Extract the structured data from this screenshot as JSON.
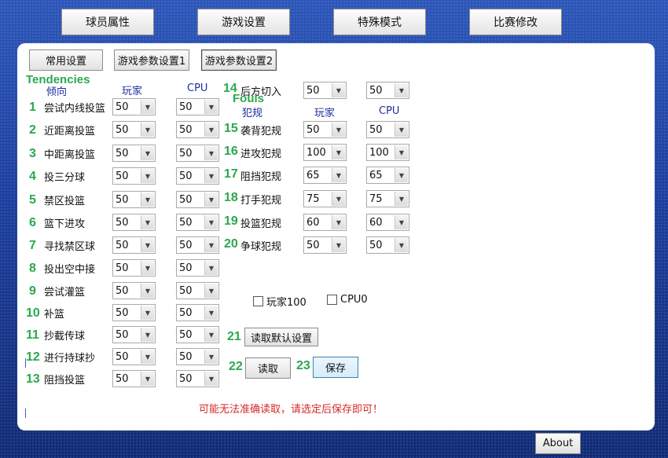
{
  "top_tabs": [
    "球员属性",
    "游戏设置",
    "特殊模式",
    "比赛修改"
  ],
  "sub_tabs": [
    "常用设置",
    "游戏参数设置1",
    "游戏参数设置2"
  ],
  "tendencies": {
    "title": "Tendencies",
    "col_label": "倾向",
    "col_player": "玩家",
    "col_cpu": "CPU",
    "rows": [
      {
        "num": "1",
        "label": "尝试内线投篮",
        "player": "50",
        "cpu": "50"
      },
      {
        "num": "2",
        "label": "近距离投篮",
        "player": "50",
        "cpu": "50"
      },
      {
        "num": "3",
        "label": "中距离投篮",
        "player": "50",
        "cpu": "50"
      },
      {
        "num": "4",
        "label": "投三分球",
        "player": "50",
        "cpu": "50"
      },
      {
        "num": "5",
        "label": "禁区投篮",
        "player": "50",
        "cpu": "50"
      },
      {
        "num": "6",
        "label": "篮下进攻",
        "player": "50",
        "cpu": "50"
      },
      {
        "num": "7",
        "label": "寻找禁区球",
        "player": "50",
        "cpu": "50"
      },
      {
        "num": "8",
        "label": "投出空中接",
        "player": "50",
        "cpu": "50"
      },
      {
        "num": "9",
        "label": "尝试灌篮",
        "player": "50",
        "cpu": "50"
      },
      {
        "num": "10",
        "label": "补篮",
        "player": "50",
        "cpu": "50"
      },
      {
        "num": "11",
        "label": "抄截传球",
        "player": "50",
        "cpu": "50"
      },
      {
        "num": "12",
        "label": "进行持球抄",
        "player": "50",
        "cpu": "50"
      },
      {
        "num": "13",
        "label": "阻挡投篮",
        "player": "50",
        "cpu": "50"
      }
    ],
    "row14": {
      "num": "14",
      "label": "后方切入",
      "player": "50",
      "cpu": "50"
    }
  },
  "fouls": {
    "title": "Fouls",
    "col_label": "犯规",
    "col_player": "玩家",
    "col_cpu": "CPU",
    "rows": [
      {
        "num": "15",
        "label": "袭背犯规",
        "player": "50",
        "cpu": "50"
      },
      {
        "num": "16",
        "label": "进攻犯规",
        "player": "100",
        "cpu": "100"
      },
      {
        "num": "17",
        "label": "阻挡犯规",
        "player": "65",
        "cpu": "65"
      },
      {
        "num": "18",
        "label": "打手犯规",
        "player": "75",
        "cpu": "75"
      },
      {
        "num": "19",
        "label": "投篮犯规",
        "player": "60",
        "cpu": "60"
      },
      {
        "num": "20",
        "label": "争球犯规",
        "player": "50",
        "cpu": "50"
      }
    ]
  },
  "checkboxes": [
    {
      "label": "玩家100",
      "checked": false
    },
    {
      "label": "CPU0",
      "checked": false
    }
  ],
  "actions": {
    "n21": "21",
    "load_default": "读取默认设置",
    "n22": "22",
    "read": "读取",
    "n23": "23",
    "save": "保存"
  },
  "warning": "可能无法准确读取，请选定后保存即可！",
  "about": "About",
  "colors": {
    "accent_green": "#2aa84f",
    "warning_red": "#d42a2a",
    "header_blue": "#1b2f9e"
  }
}
